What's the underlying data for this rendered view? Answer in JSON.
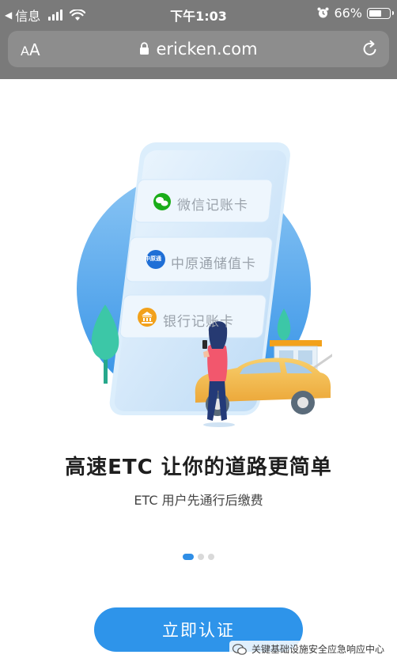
{
  "status_bar": {
    "back_label": "信息",
    "time": "下午1:03",
    "battery": "66%",
    "battery_level": 0.66
  },
  "browser": {
    "text_size_small": "A",
    "text_size_big": "A",
    "url": "ericken.com"
  },
  "hero": {
    "cards": [
      {
        "label": "微信记账卡",
        "icon": "wechat-icon",
        "color": "#1aad19"
      },
      {
        "label": "中原通储值卡",
        "icon": "zhongyuan-logo-icon",
        "icon_text": "中原通",
        "color": "#1f6fd6"
      },
      {
        "label": "银行记账卡",
        "icon": "bank-icon",
        "color": "#f2a11b"
      }
    ]
  },
  "headline": "高速ETC 让你的道路更简单",
  "subhead": "ETC 用户先通行后缴费",
  "pagination": {
    "current": 1,
    "total": 3
  },
  "cta_label": "立即认证",
  "watermark": "关键基础设施安全应急响应中心",
  "colors": {
    "accent": "#2e94ea",
    "chrome": "#7a7a7a"
  }
}
